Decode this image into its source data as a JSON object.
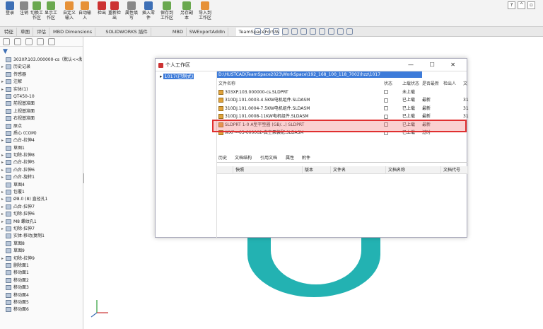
{
  "ribbon": {
    "buttons": [
      {
        "label": "登录",
        "icon": "user-icon"
      },
      {
        "label": "注销",
        "icon": "logout-icon"
      },
      {
        "label": "切换工作区",
        "icon": "switch-icon"
      },
      {
        "label": "显示工作区",
        "icon": "show-icon"
      },
      {
        "label": "自定义输入",
        "icon": "input-icon"
      },
      {
        "label": "自动输入",
        "icon": "auto-input-icon"
      },
      {
        "label": "检出",
        "icon": "checkout-icon"
      },
      {
        "label": "重新检出",
        "icon": "recheckout-icon"
      },
      {
        "label": "属性填写",
        "icon": "property-icon"
      },
      {
        "label": "插入零件",
        "icon": "insert-part-icon"
      },
      {
        "label": "保存到工作区",
        "icon": "save-icon"
      },
      {
        "label": "另存副本",
        "icon": "save-copy-icon"
      },
      {
        "label": "导入到工作区",
        "icon": "import-icon"
      }
    ]
  },
  "tabs": [
    "特征",
    "草图",
    "评估",
    "MBD Dimensions",
    "SOLIDWORKS 插件",
    "MBD",
    "SWExportAddIn",
    "TeamSpaceForSW"
  ],
  "active_tab": 7,
  "tree": [
    {
      "label": "303XP.103.000000-cs（默认<<默认",
      "arrow": ""
    },
    {
      "label": "历史记录",
      "arrow": "▸"
    },
    {
      "label": "传感器",
      "arrow": ""
    },
    {
      "label": "注解",
      "arrow": "▸"
    },
    {
      "label": "实体(1)",
      "arrow": "▸"
    },
    {
      "label": "QT450-10",
      "arrow": ""
    },
    {
      "label": "前视基准面",
      "arrow": ""
    },
    {
      "label": "上视基准面",
      "arrow": ""
    },
    {
      "label": "右视基准面",
      "arrow": ""
    },
    {
      "label": "原点",
      "arrow": ""
    },
    {
      "label": "质心 (COM)",
      "arrow": ""
    },
    {
      "label": "凸台-拉伸4",
      "arrow": "▸"
    },
    {
      "label": "草图1",
      "arrow": ""
    },
    {
      "label": "切除-拉伸8",
      "arrow": "▸"
    },
    {
      "label": "凸台-拉伸5",
      "arrow": "▸"
    },
    {
      "label": "凸台-拉伸6",
      "arrow": "▸"
    },
    {
      "label": "凸台-旋转1",
      "arrow": "▸"
    },
    {
      "label": "草图4",
      "arrow": ""
    },
    {
      "label": "包覆1",
      "arrow": "▸"
    },
    {
      "label": "Ø8.0 (8) 直径孔1",
      "arrow": "▸"
    },
    {
      "label": "凸台-拉伸7",
      "arrow": "▸"
    },
    {
      "label": "切除-拉伸6",
      "arrow": "▸"
    },
    {
      "label": "M8 螺纹孔1",
      "arrow": "▸"
    },
    {
      "label": "切除-拉伸7",
      "arrow": "▸"
    },
    {
      "label": "实体-移动/复制1",
      "arrow": ""
    },
    {
      "label": "草图8",
      "arrow": ""
    },
    {
      "label": "草图9",
      "arrow": ""
    },
    {
      "label": "切除-拉伸9",
      "arrow": "▸"
    },
    {
      "label": "删除面1",
      "arrow": ""
    },
    {
      "label": "移动面1",
      "arrow": ""
    },
    {
      "label": "移动面2",
      "arrow": ""
    },
    {
      "label": "移动面3",
      "arrow": ""
    },
    {
      "label": "移动面4",
      "arrow": ""
    },
    {
      "label": "移动面5",
      "arrow": ""
    },
    {
      "label": "移动面6",
      "arrow": ""
    }
  ],
  "window": {
    "title": "个人工作区",
    "controls": "— ☐ ✕",
    "tree_node": "1017(已制式)",
    "path": "D:\\HUSTCAD\\TeamSpace2023\\WorkSpace\\192_168_100_118_7002\\hzz\\1017",
    "headers": [
      "文件名称",
      "状态",
      "上载状态",
      "是否最新",
      "检出人",
      "文"
    ],
    "rows": [
      [
        "303XP.103.000000-cs.SLDPRT",
        "",
        "未上载",
        "",
        "",
        ""
      ],
      [
        "310DJ.101.0003-4.5KW电机组件.SLDASM",
        "",
        "已上载",
        "最新",
        "",
        "31"
      ],
      [
        "310DJ.101.0004-7.5KW电机组件.SLDASM",
        "",
        "已上载",
        "最新",
        "",
        "31"
      ],
      [
        "310DJ.101.0008-11KW电机组件.SLDASM",
        "",
        "已上载",
        "最新",
        "",
        "31"
      ],
      [
        "SLDPRT 1-0 A型平垫圈 (GB/...) SLDPRT",
        "",
        "已上载",
        "最新",
        "",
        ""
      ],
      [
        "WXP---03-000002-真空泵装配.SLDASM",
        "",
        "已上载",
        "过时",
        "",
        ""
      ]
    ],
    "bottom_tabs": [
      "历史",
      "文档结构",
      "引用文档",
      "属性",
      "附件"
    ],
    "bottom_headers": [
      "快照",
      "版本",
      "文件名",
      "文档名称",
      "文档代号"
    ]
  }
}
